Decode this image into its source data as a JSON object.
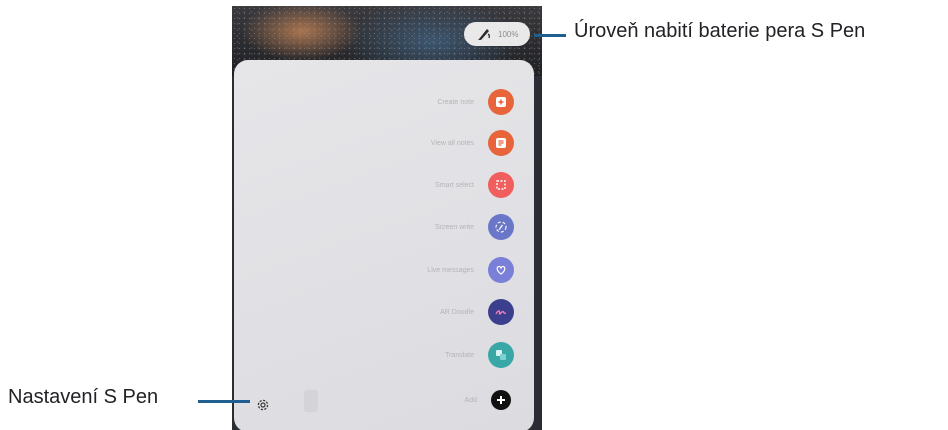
{
  "callouts": {
    "battery": "Úroveň nabití baterie pera S Pen",
    "settings": "Nastavení S Pen"
  },
  "status": {
    "battery_percent": "100%"
  },
  "menu": {
    "items": [
      {
        "label": "Create note",
        "icon": "create-note-icon",
        "color": "#e8643b"
      },
      {
        "label": "View all notes",
        "icon": "view-all-notes-icon",
        "color": "#e8643b"
      },
      {
        "label": "Smart select",
        "icon": "smart-select-icon",
        "color": "#f05e5e"
      },
      {
        "label": "Screen write",
        "icon": "screen-write-icon",
        "color": "#6a76c8"
      },
      {
        "label": "Live messages",
        "icon": "live-messages-icon",
        "color": "#7a7fd8"
      },
      {
        "label": "AR Doodle",
        "icon": "ar-doodle-icon",
        "color": "#3c3f8e"
      },
      {
        "label": "Translate",
        "icon": "translate-icon",
        "color": "#3aa7a7"
      },
      {
        "label": "Add",
        "icon": "add-icon",
        "color": "#111111"
      }
    ]
  },
  "colors": {
    "callout_line": "#1f5f8f",
    "panel": "#e3e3e7"
  }
}
